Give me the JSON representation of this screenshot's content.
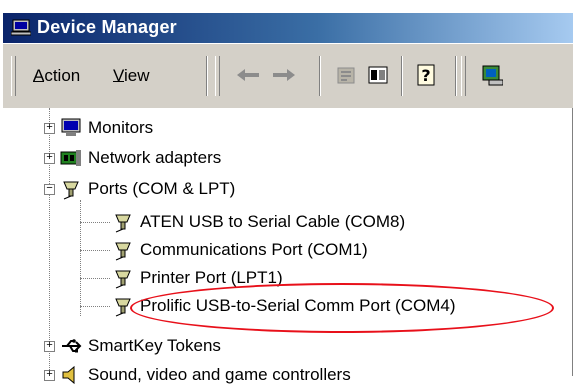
{
  "window": {
    "title": "Device Manager",
    "title_icon": "computer-icon"
  },
  "menu": {
    "action_label": "Action",
    "action_mnemonic": "A",
    "view_label": "View",
    "view_mnemonic": "V"
  },
  "toolbar": {
    "buttons": [
      {
        "name": "back-arrow-icon"
      },
      {
        "name": "forward-arrow-icon"
      },
      {
        "name": "properties-icon"
      },
      {
        "name": "view-toggle-icon"
      },
      {
        "name": "help-icon"
      },
      {
        "name": "scan-hardware-icon"
      }
    ]
  },
  "tree": {
    "items": [
      {
        "label": "Monitors",
        "icon": "monitor-icon",
        "expanded": false,
        "level": 0
      },
      {
        "label": "Network adapters",
        "icon": "network-adapter-icon",
        "expanded": false,
        "level": 0
      },
      {
        "label": "Ports (COM & LPT)",
        "icon": "port-icon",
        "expanded": true,
        "level": 0
      },
      {
        "label": "ATEN USB to Serial Cable (COM8)",
        "icon": "port-icon",
        "level": 1
      },
      {
        "label": "Communications Port (COM1)",
        "icon": "port-icon",
        "level": 1
      },
      {
        "label": "Printer Port (LPT1)",
        "icon": "port-icon",
        "level": 1
      },
      {
        "label": "Prolific USB-to-Serial Comm Port (COM4)",
        "icon": "port-icon",
        "level": 1,
        "highlighted": true
      },
      {
        "label": "SmartKey Tokens",
        "icon": "usb-icon",
        "expanded": false,
        "level": 0
      },
      {
        "label": "Sound, video and game controllers",
        "icon": "sound-icon",
        "expanded": false,
        "level": 0
      }
    ]
  },
  "colors": {
    "titlebar_start": "#0a246a",
    "titlebar_end": "#a6caf0",
    "highlight_ring": "#e8101a",
    "toolbar_bg": "#d4d0c8"
  }
}
